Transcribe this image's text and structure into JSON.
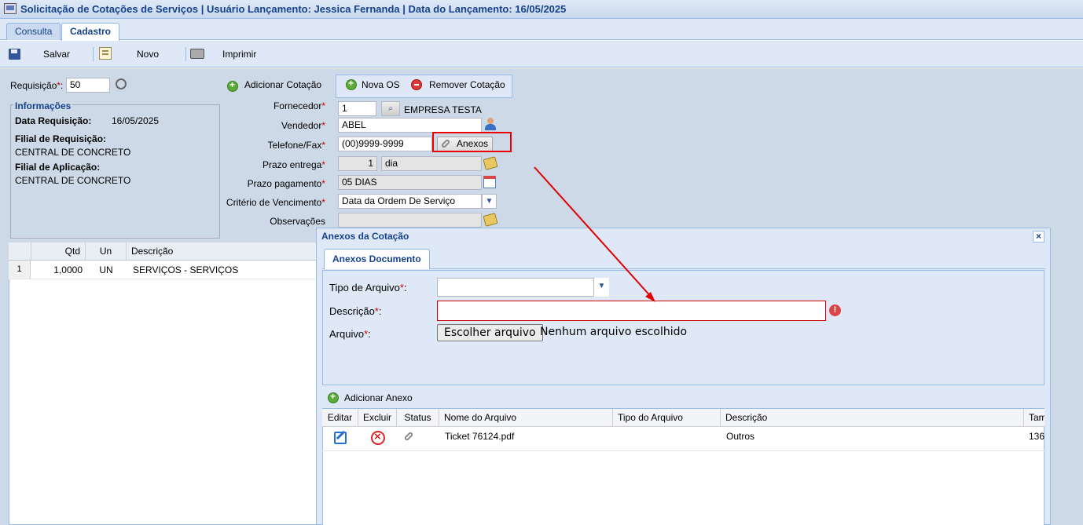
{
  "window": {
    "title": "Solicitação de Cotações de Serviços | Usuário Lançamento: Jessica Fernanda | Data do Lançamento: 16/05/2025"
  },
  "tabs": [
    {
      "label": "Consulta",
      "active": false
    },
    {
      "label": "Cadastro",
      "active": true
    }
  ],
  "toolbar": {
    "save": "Salvar",
    "new": "Novo",
    "print": "Imprimir"
  },
  "requisicao": {
    "label": "Requisição",
    "value": "50",
    "add_cotacao": "Adicionar Cotação"
  },
  "cotacao_actions": {
    "nova_os": "Nova OS",
    "remover": "Remover Cotação"
  },
  "informacoes": {
    "legend": "Informações",
    "data_req_label": "Data Requisição:",
    "data_req_value": "16/05/2025",
    "filial_req_label": "Filial de Requisição:",
    "filial_req_value": "CENTRAL DE CONCRETO",
    "filial_apl_label": "Filial de Aplicação:",
    "filial_apl_value": "CENTRAL DE CONCRETO"
  },
  "form": {
    "fornecedor_label": "Fornecedor",
    "fornecedor_code": "1",
    "fornecedor_name": "EMPRESA TESTA",
    "vendedor_label": "Vendedor",
    "vendedor_value": "ABEL",
    "telefone_label": "Telefone/Fax",
    "telefone_value": "(00)9999-9999",
    "anexos_button": "Anexos",
    "prazo_entrega_label": "Prazo entrega",
    "prazo_entrega_value": "1",
    "prazo_entrega_unit": "dia",
    "prazo_pag_label": "Prazo pagamento",
    "prazo_pag_value": "05 DIAS",
    "criterio_label": "Critério de Vencimento",
    "criterio_value": "Data da Ordem De Serviço",
    "obs_label": "Observações"
  },
  "items_grid": {
    "headers": [
      "Qtd",
      "Un",
      "Descrição"
    ],
    "rows": [
      {
        "num": "1",
        "qtd": "1,0000",
        "un": "UN",
        "desc": "SERVIÇOS - SERVIÇOS"
      }
    ]
  },
  "modal": {
    "title": "Anexos da Cotação",
    "close": "×",
    "tab": "Anexos Documento",
    "tipo_label": "Tipo de Arquivo",
    "descricao_label": "Descrição",
    "arquivo_label": "Arquivo",
    "file_button": "Escolher arquivo",
    "file_none": "Nenhum arquivo escolhido",
    "add_anexo": "Adicionar Anexo",
    "grid_headers": [
      "Editar",
      "Excluir",
      "Status",
      "Nome do Arquivo",
      "Tipo do Arquivo",
      "Descrição",
      "Tam"
    ],
    "grid_rows": [
      {
        "nome": "Ticket 76124.pdf",
        "tipo": "",
        "descricao": "Outros",
        "tam": "136"
      }
    ]
  },
  "annotation_color": "#e00000"
}
